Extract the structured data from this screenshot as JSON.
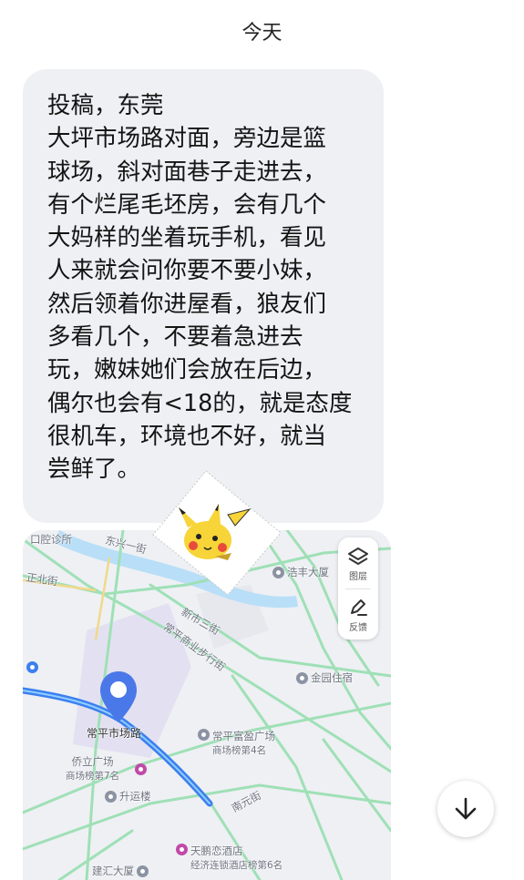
{
  "header": {
    "date": "今天"
  },
  "message": {
    "lines": [
      "投稿，东莞",
      "大坪市场路对面，旁边是篮",
      "球场，斜对面巷子走进去，",
      "有个烂尾毛坯房，会有几个",
      "大妈样的坐着玩手机，看见",
      "人来就会问你要不要小妹，",
      "然后领着你进屋看，狼友们",
      "多看几个，不要着急进去",
      "玩，嫩妹她们会放在后边，",
      "偶尔也会有<18的，就是态度",
      "很机车，环境也不好，就当",
      "尝鲜了。"
    ]
  },
  "map": {
    "pin_label": "常平市场路",
    "tools": {
      "layers_label": "图层",
      "feedback_label": "反馈"
    },
    "labels": {
      "clinic": "口腔诊所",
      "dongwo": "东兴一街",
      "zhengbei": "正北街",
      "haofeng": "浩丰大厦",
      "shixin": "新市三街",
      "pedestrian": "常平商业步行街",
      "jinyuan": "金园住宿",
      "fuying": "常平富盈广场",
      "fuying_rank": "商场榜第4名",
      "qiaoli": "侨立广场",
      "qiaoli_rank": "商场榜第7名",
      "shengyun": "升运楼",
      "nanyuan": "南元街",
      "hotel": "天鹏恋酒店",
      "hotel_rank": "经济连锁酒店榜第6名",
      "jianhui": "建汇大厦"
    }
  },
  "colors": {
    "bubble_bg": "#eef0f3",
    "map_bg": "#eef0f4",
    "road_green": "#9fe0b6",
    "route_blue": "#3d7ff0",
    "pin_blue": "#4a78e8",
    "water": "#b8dff7",
    "poi_pink": "#c04aa7"
  },
  "icons": {
    "layers": "layers-icon",
    "feedback": "pen-icon",
    "pin": "location-pin-icon",
    "scroll": "arrow-down-icon",
    "sticker": "pikachu-sticker"
  }
}
